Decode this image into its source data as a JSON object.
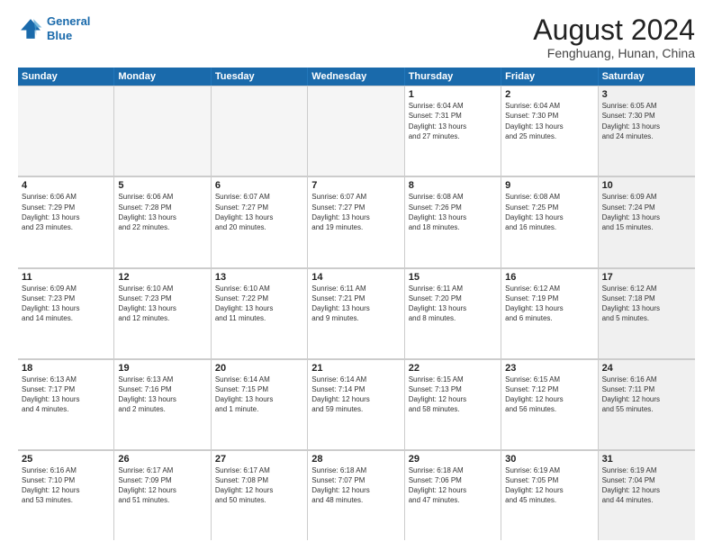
{
  "logo": {
    "line1": "General",
    "line2": "Blue"
  },
  "title": "August 2024",
  "subtitle": "Fenghuang, Hunan, China",
  "days": [
    "Sunday",
    "Monday",
    "Tuesday",
    "Wednesday",
    "Thursday",
    "Friday",
    "Saturday"
  ],
  "weeks": [
    [
      {
        "day": "",
        "info": "",
        "empty": true
      },
      {
        "day": "",
        "info": "",
        "empty": true
      },
      {
        "day": "",
        "info": "",
        "empty": true
      },
      {
        "day": "",
        "info": "",
        "empty": true
      },
      {
        "day": "1",
        "info": "Sunrise: 6:04 AM\nSunset: 7:31 PM\nDaylight: 13 hours\nand 27 minutes.",
        "empty": false
      },
      {
        "day": "2",
        "info": "Sunrise: 6:04 AM\nSunset: 7:30 PM\nDaylight: 13 hours\nand 25 minutes.",
        "empty": false
      },
      {
        "day": "3",
        "info": "Sunrise: 6:05 AM\nSunset: 7:30 PM\nDaylight: 13 hours\nand 24 minutes.",
        "empty": false,
        "shaded": true
      }
    ],
    [
      {
        "day": "4",
        "info": "Sunrise: 6:06 AM\nSunset: 7:29 PM\nDaylight: 13 hours\nand 23 minutes.",
        "empty": false
      },
      {
        "day": "5",
        "info": "Sunrise: 6:06 AM\nSunset: 7:28 PM\nDaylight: 13 hours\nand 22 minutes.",
        "empty": false
      },
      {
        "day": "6",
        "info": "Sunrise: 6:07 AM\nSunset: 7:27 PM\nDaylight: 13 hours\nand 20 minutes.",
        "empty": false
      },
      {
        "day": "7",
        "info": "Sunrise: 6:07 AM\nSunset: 7:27 PM\nDaylight: 13 hours\nand 19 minutes.",
        "empty": false
      },
      {
        "day": "8",
        "info": "Sunrise: 6:08 AM\nSunset: 7:26 PM\nDaylight: 13 hours\nand 18 minutes.",
        "empty": false
      },
      {
        "day": "9",
        "info": "Sunrise: 6:08 AM\nSunset: 7:25 PM\nDaylight: 13 hours\nand 16 minutes.",
        "empty": false
      },
      {
        "day": "10",
        "info": "Sunrise: 6:09 AM\nSunset: 7:24 PM\nDaylight: 13 hours\nand 15 minutes.",
        "empty": false,
        "shaded": true
      }
    ],
    [
      {
        "day": "11",
        "info": "Sunrise: 6:09 AM\nSunset: 7:23 PM\nDaylight: 13 hours\nand 14 minutes.",
        "empty": false
      },
      {
        "day": "12",
        "info": "Sunrise: 6:10 AM\nSunset: 7:23 PM\nDaylight: 13 hours\nand 12 minutes.",
        "empty": false
      },
      {
        "day": "13",
        "info": "Sunrise: 6:10 AM\nSunset: 7:22 PM\nDaylight: 13 hours\nand 11 minutes.",
        "empty": false
      },
      {
        "day": "14",
        "info": "Sunrise: 6:11 AM\nSunset: 7:21 PM\nDaylight: 13 hours\nand 9 minutes.",
        "empty": false
      },
      {
        "day": "15",
        "info": "Sunrise: 6:11 AM\nSunset: 7:20 PM\nDaylight: 13 hours\nand 8 minutes.",
        "empty": false
      },
      {
        "day": "16",
        "info": "Sunrise: 6:12 AM\nSunset: 7:19 PM\nDaylight: 13 hours\nand 6 minutes.",
        "empty": false
      },
      {
        "day": "17",
        "info": "Sunrise: 6:12 AM\nSunset: 7:18 PM\nDaylight: 13 hours\nand 5 minutes.",
        "empty": false,
        "shaded": true
      }
    ],
    [
      {
        "day": "18",
        "info": "Sunrise: 6:13 AM\nSunset: 7:17 PM\nDaylight: 13 hours\nand 4 minutes.",
        "empty": false
      },
      {
        "day": "19",
        "info": "Sunrise: 6:13 AM\nSunset: 7:16 PM\nDaylight: 13 hours\nand 2 minutes.",
        "empty": false
      },
      {
        "day": "20",
        "info": "Sunrise: 6:14 AM\nSunset: 7:15 PM\nDaylight: 13 hours\nand 1 minute.",
        "empty": false
      },
      {
        "day": "21",
        "info": "Sunrise: 6:14 AM\nSunset: 7:14 PM\nDaylight: 12 hours\nand 59 minutes.",
        "empty": false
      },
      {
        "day": "22",
        "info": "Sunrise: 6:15 AM\nSunset: 7:13 PM\nDaylight: 12 hours\nand 58 minutes.",
        "empty": false
      },
      {
        "day": "23",
        "info": "Sunrise: 6:15 AM\nSunset: 7:12 PM\nDaylight: 12 hours\nand 56 minutes.",
        "empty": false
      },
      {
        "day": "24",
        "info": "Sunrise: 6:16 AM\nSunset: 7:11 PM\nDaylight: 12 hours\nand 55 minutes.",
        "empty": false,
        "shaded": true
      }
    ],
    [
      {
        "day": "25",
        "info": "Sunrise: 6:16 AM\nSunset: 7:10 PM\nDaylight: 12 hours\nand 53 minutes.",
        "empty": false
      },
      {
        "day": "26",
        "info": "Sunrise: 6:17 AM\nSunset: 7:09 PM\nDaylight: 12 hours\nand 51 minutes.",
        "empty": false
      },
      {
        "day": "27",
        "info": "Sunrise: 6:17 AM\nSunset: 7:08 PM\nDaylight: 12 hours\nand 50 minutes.",
        "empty": false
      },
      {
        "day": "28",
        "info": "Sunrise: 6:18 AM\nSunset: 7:07 PM\nDaylight: 12 hours\nand 48 minutes.",
        "empty": false
      },
      {
        "day": "29",
        "info": "Sunrise: 6:18 AM\nSunset: 7:06 PM\nDaylight: 12 hours\nand 47 minutes.",
        "empty": false
      },
      {
        "day": "30",
        "info": "Sunrise: 6:19 AM\nSunset: 7:05 PM\nDaylight: 12 hours\nand 45 minutes.",
        "empty": false
      },
      {
        "day": "31",
        "info": "Sunrise: 6:19 AM\nSunset: 7:04 PM\nDaylight: 12 hours\nand 44 minutes.",
        "empty": false,
        "shaded": true
      }
    ]
  ]
}
